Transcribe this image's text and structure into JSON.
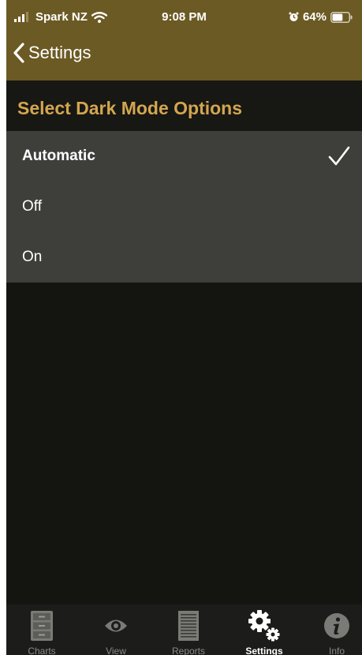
{
  "status_bar": {
    "carrier": "Spark NZ",
    "time": "9:08 PM",
    "battery_percent": "64%",
    "battery_level": 0.64,
    "icons": [
      "signal-icon",
      "wifi-icon",
      "alarm-icon",
      "battery-icon"
    ]
  },
  "nav": {
    "back_label": "Settings",
    "back_icon": "chevron-left-icon"
  },
  "section": {
    "title": "Select Dark Mode Options"
  },
  "options": [
    {
      "label": "Automatic",
      "selected": true
    },
    {
      "label": "Off",
      "selected": false
    },
    {
      "label": "On",
      "selected": false
    }
  ],
  "tabs": [
    {
      "label": "Charts",
      "icon": "file-cabinet-icon",
      "active": false
    },
    {
      "label": "View",
      "icon": "eye-icon",
      "active": false
    },
    {
      "label": "Reports",
      "icon": "document-icon",
      "active": false
    },
    {
      "label": "Settings",
      "icon": "gears-icon",
      "active": true
    },
    {
      "label": "Info",
      "icon": "info-icon",
      "active": false
    }
  ],
  "colors": {
    "header_bg": "#6c5a24",
    "accent_title": "#d3a650",
    "list_bg": "#3e3e3b",
    "page_bg": "#141411",
    "tab_bg": "#1c1c1a"
  }
}
